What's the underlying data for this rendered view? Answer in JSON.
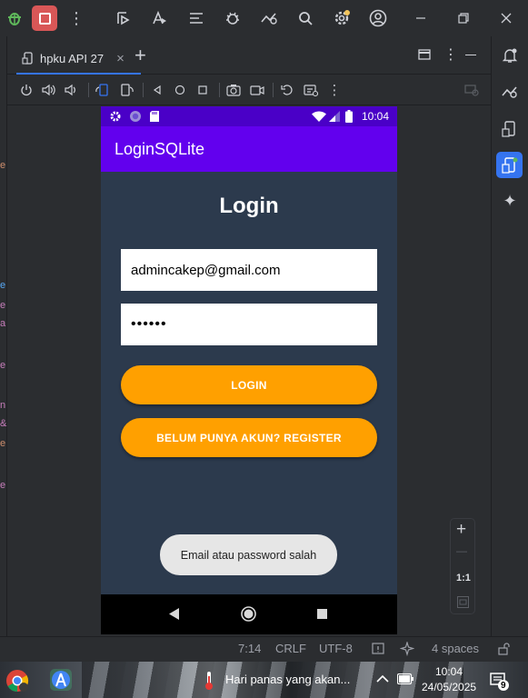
{
  "titlebar": {
    "icons": [
      "bug-icon",
      "stop-icon",
      "more-vert-icon",
      "run-test-icon",
      "translate-icon",
      "list-icon",
      "gear-bug-icon",
      "profiler-icon",
      "search-icon",
      "settings-icon",
      "account-icon",
      "minimize-icon",
      "restore-icon",
      "close-icon"
    ]
  },
  "tab": {
    "label": "hpku API 27",
    "close": "×",
    "add": "+"
  },
  "device": {
    "statusbar": {
      "time": "10:04"
    },
    "app": {
      "title": "LoginSQLite",
      "heading": "Login",
      "email_value": "admincakep@gmail.com",
      "password_value": "••••••",
      "login_button": "LOGIN",
      "register_button": "BELUM PUNYA AKUN? REGISTER",
      "toast": "Email atau password salah"
    }
  },
  "zoom": {
    "plus": "+",
    "minus": "—",
    "reset": "1:1"
  },
  "statusline": {
    "position": "7:14",
    "line_ending": "CRLF",
    "encoding": "UTF-8",
    "indent": "4 spaces"
  },
  "taskbar": {
    "weather": "Hari panas yang akan...",
    "time": "10:04",
    "date": "24/05/2025",
    "notif_count": "9"
  },
  "colors": {
    "accent": "#3574f0",
    "app_primary": "#6200ee",
    "status_primary_dark": "#4a00c7",
    "button": "#ffa000",
    "app_bg": "#2c3a4d"
  }
}
